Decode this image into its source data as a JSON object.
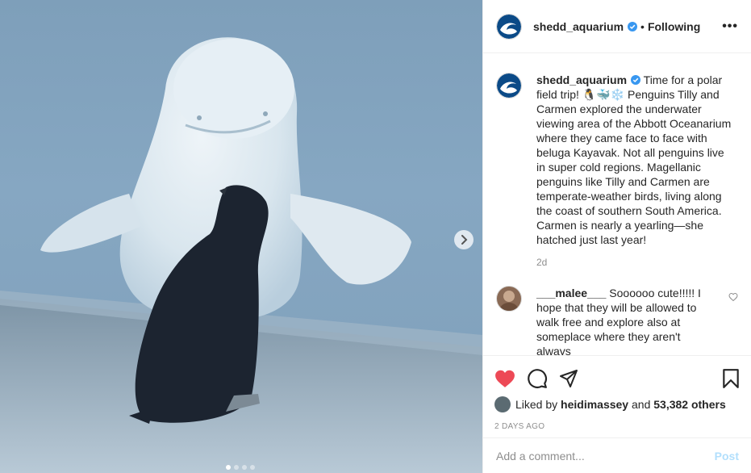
{
  "colors": {
    "accent": "#0095f6",
    "like_red": "#ed4956",
    "post_disabled": "#b2dffc",
    "muted": "#8e8e8e"
  },
  "media": {
    "carousel_total": 4,
    "carousel_active": 1,
    "next_icon": "chevron-right-icon"
  },
  "header": {
    "username": "shedd_aquarium",
    "separator": "•",
    "follow_status": "Following",
    "more_label": "•••"
  },
  "caption": {
    "username": "shedd_aquarium",
    "text_line1": " Time for a polar field trip! ",
    "emojis": "🐧🐳❄️",
    "text_rest": " Penguins Tilly and Carmen explored the underwater viewing area of the Abbott Oceanarium where they came face to face with beluga Kayavak. Not all penguins live in super cold regions. Magellanic penguins like Tilly and Carmen are temperate-weather birds, living along the coast of southern South America. Carmen is nearly a yearling—she hatched just last year!",
    "time": "2d"
  },
  "comments": [
    {
      "username": "___malee___",
      "text": " Soooooo cute!!!!! I hope that they will be allowed to walk free and explore also at someplace where they aren't always"
    }
  ],
  "actions": {
    "like_icon": "heart-filled-icon",
    "comment_icon": "comment-icon",
    "share_icon": "share-icon",
    "save_icon": "bookmark-icon"
  },
  "likes": {
    "prefix": "Liked by ",
    "user": "heidimassey",
    "middle": " and ",
    "count": "53,382 others"
  },
  "timestamp": "2 DAYS AGO",
  "add_comment": {
    "placeholder": "Add a comment...",
    "post_label": "Post"
  }
}
